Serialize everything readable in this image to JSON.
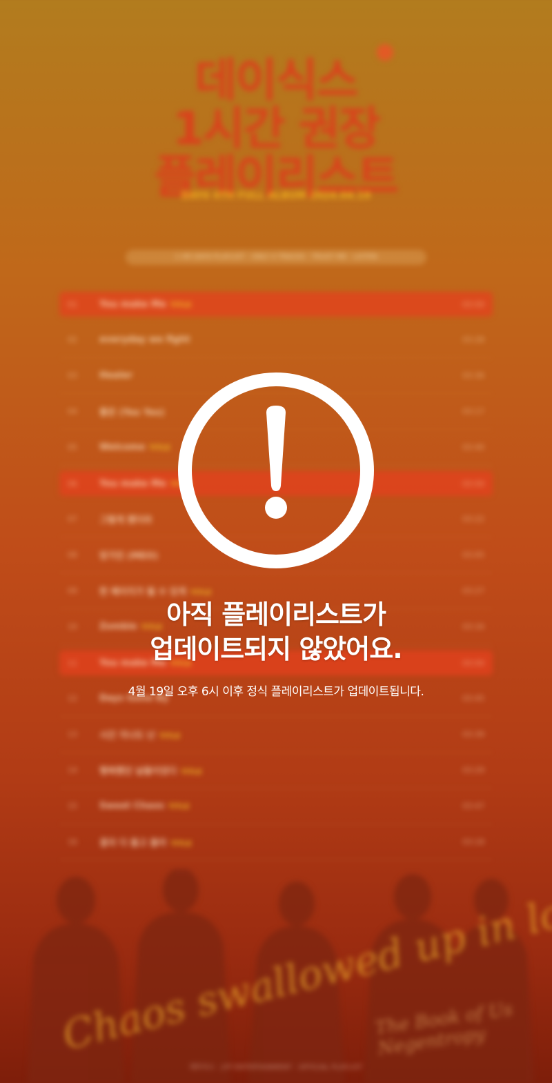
{
  "poster": {
    "title_line1": "데이식스",
    "title_line2": "1시간 권장",
    "title_line3": "플레이리스트",
    "subtitle": "DAY6 4TH FULL ALBUM 2024.04.19",
    "info": "1 HR DAY6 PLAYLIST · ONLY 4 TRACKS · TRUST ME · LISTEN",
    "tracks": [
      {
        "num": "01",
        "title": "You make Me",
        "tag": "TITLE",
        "time": "03:50",
        "highlight": true
      },
      {
        "num": "02",
        "title": "everyday we fight",
        "tag": "",
        "time": "03:28",
        "highlight": false
      },
      {
        "num": "03",
        "title": "Healer",
        "tag": "",
        "time": "03:36",
        "highlight": false
      },
      {
        "num": "04",
        "title": "좋은 (Yes Yes)",
        "tag": "",
        "time": "03:17",
        "highlight": false
      },
      {
        "num": "05",
        "title": "Welcome",
        "tag": "TITLE",
        "time": "03:40",
        "highlight": false
      },
      {
        "num": "06",
        "title": "You make Me",
        "tag": "TITLE",
        "time": "03:50",
        "highlight": true
      },
      {
        "num": "07",
        "title": "그렇게 됐더라",
        "tag": "",
        "time": "03:22",
        "highlight": false
      },
      {
        "num": "08",
        "title": "망가진 (MEO)",
        "tag": "",
        "time": "03:05",
        "highlight": false
      },
      {
        "num": "09",
        "title": "한 페이지가 될 수 있게",
        "tag": "TITLE",
        "time": "03:27",
        "highlight": false
      },
      {
        "num": "10",
        "title": "Zombie",
        "tag": "TITLE",
        "time": "03:16",
        "highlight": false
      },
      {
        "num": "11",
        "title": "You make Me",
        "tag": "TITLE",
        "time": "03:50",
        "highlight": true
      },
      {
        "num": "12",
        "title": "Days Gone By",
        "tag": "",
        "time": "03:45",
        "highlight": false
      },
      {
        "num": "13",
        "title": "시간 지나도 난",
        "tag": "TITLE",
        "time": "03:39",
        "highlight": false
      },
      {
        "num": "14",
        "title": "행복했던 날들이었다",
        "tag": "TITLE",
        "time": "03:29",
        "highlight": false
      },
      {
        "num": "15",
        "title": "Sweet Chaos",
        "tag": "TITLE",
        "time": "03:47",
        "highlight": false
      },
      {
        "num": "16",
        "title": "결국 다 돌고 돌아",
        "tag": "TITLE",
        "time": "03:18",
        "highlight": false
      }
    ],
    "script": "Chaos swallowed up in love",
    "album_line1": "The Book of Us",
    "album_line2": "Negentropy",
    "footer": "데이식스 · JYP ENTERTAINMENT · OFFICIAL PLAYLIST"
  },
  "notice": {
    "title_line1": "아직 플레이리스트가",
    "title_line2": "업데이트되지 않았어요.",
    "subtitle": "4월 19일 오후 6시 이후 정식 플레이리스트가 업데이트됩니다."
  },
  "colors": {
    "icon": "#ffffff",
    "title_red": "#d9421c",
    "accent_yellow": "#f3c02a"
  }
}
